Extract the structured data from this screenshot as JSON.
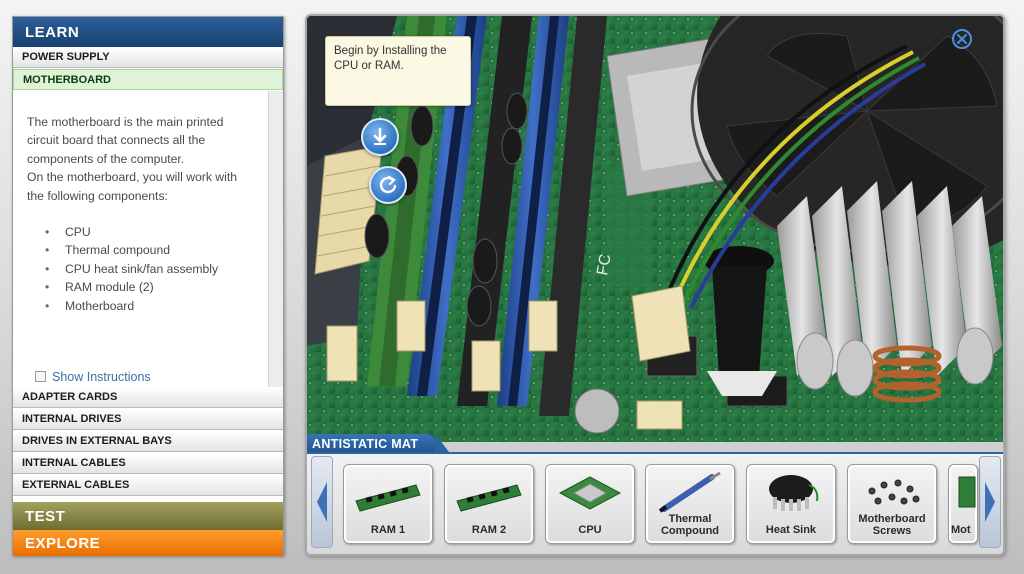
{
  "learn_panel": {
    "header": "LEARN",
    "top_items": [
      "POWER SUPPLY",
      "MOTHERBOARD"
    ],
    "content": {
      "paragraphs": [
        "The motherboard is the main printed circuit board that connects all the components of the computer.",
        "On the motherboard, you will work with the following components:"
      ],
      "components": [
        "CPU",
        "Thermal compound",
        "CPU heat sink/fan assembly",
        "RAM module (2)",
        "Motherboard"
      ]
    },
    "show_instructions": "Show Instructions",
    "bottom_items": [
      "ADAPTER CARDS",
      "INTERNAL DRIVES",
      "DRIVES IN EXTERNAL BAYS",
      "INTERNAL CABLES",
      "EXTERNAL CABLES"
    ],
    "test_label": "TEST",
    "explore_label": "EXPLORE"
  },
  "viewer": {
    "tooltip": "Begin by Installing the CPU or RAM.",
    "tray": {
      "label": "ANTISTATIC MAT",
      "items": [
        {
          "label": "RAM 1",
          "icon": "ram-icon"
        },
        {
          "label": "RAM 2",
          "icon": "ram-icon"
        },
        {
          "label": "CPU",
          "icon": "cpu-icon"
        },
        {
          "label": "Thermal Compound",
          "icon": "thermal-syringe-icon"
        },
        {
          "label": "Heat Sink",
          "icon": "heat-sink-icon"
        },
        {
          "label": "Motherboard Screws",
          "icon": "screws-icon"
        },
        {
          "label": "Mot",
          "icon": "motherboard-icon"
        }
      ]
    }
  },
  "colors": {
    "learn_header": "#1f4f86",
    "active_item": "#dff3d7",
    "test_bar": "#8b8a45",
    "explore_bar": "#f5880f",
    "tray_accent": "#2b63a4"
  }
}
